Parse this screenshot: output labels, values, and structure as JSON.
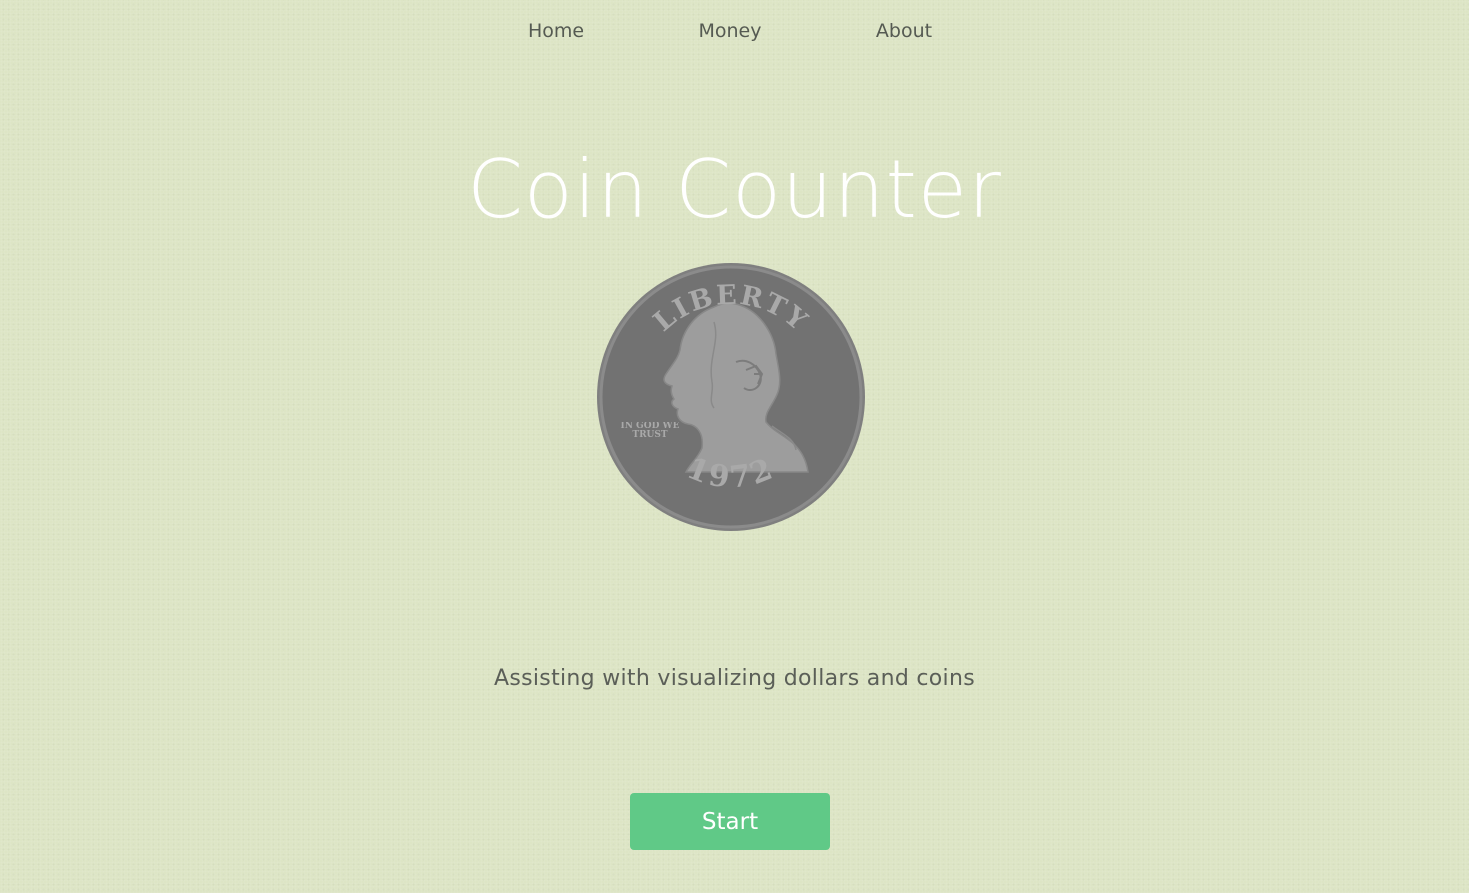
{
  "nav": {
    "items": [
      {
        "label": "Home"
      },
      {
        "label": "Money"
      },
      {
        "label": "About"
      }
    ]
  },
  "hero": {
    "title": "Coin Counter",
    "tagline": "Assisting with visualizing dollars and coins",
    "start_label": "Start"
  },
  "coin": {
    "icon": "quarter-coin-icon",
    "top_text": "LIBERTY",
    "motto": "IN GOD WE TRUST",
    "year": "1972"
  },
  "colors": {
    "background": "#dde5c5",
    "button": "#60c987",
    "title": "#ffffff",
    "text": "#5b5f58"
  }
}
